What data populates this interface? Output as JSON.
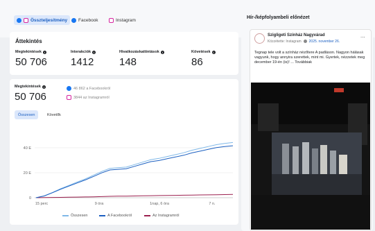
{
  "tabs": [
    {
      "label": "Összteljesítmény",
      "icon": "fb-ig-combined-icon"
    },
    {
      "label": "Facebook",
      "icon": "facebook-icon"
    },
    {
      "label": "Instagram",
      "icon": "instagram-icon"
    }
  ],
  "overview": {
    "title": "Áttekintés",
    "metrics": [
      {
        "label": "Megtekintések",
        "value": "50 706"
      },
      {
        "label": "Interakciók",
        "value": "1412"
      },
      {
        "label": "Hivatkozáskattintások",
        "value": "148"
      },
      {
        "label": "Követések",
        "value": "86"
      }
    ]
  },
  "views": {
    "label": "Megtekintések",
    "value": "50 706",
    "facebook": "46 862 a Facebookról",
    "instagram": "3844 az Instagramról",
    "toggle": [
      "Összesen",
      "Követők"
    ]
  },
  "chart_data": {
    "type": "line",
    "x_ticks": [
      "15 perc",
      "9 óra",
      "1nap, 6 óra",
      "7 n."
    ],
    "y_ticks": [
      "0",
      "20 E",
      "40 E"
    ],
    "ylim": [
      0,
      50000
    ],
    "series": [
      {
        "name": "Összesen",
        "color": "#7fb8e8",
        "values": [
          0,
          1500,
          4200,
          7200,
          9800,
          12500,
          15000,
          18000,
          21000,
          23500,
          24000,
          24500,
          26500,
          28500,
          30500,
          31500,
          33000,
          34500,
          36000,
          38000,
          39500,
          41000,
          42500,
          43500,
          44200
        ]
      },
      {
        "name": "A Facebookról",
        "color": "#1b5fc1",
        "values": [
          0,
          1400,
          4000,
          6800,
          9300,
          11800,
          14200,
          17000,
          19900,
          22200,
          22700,
          23200,
          25100,
          27000,
          28900,
          29800,
          31200,
          32600,
          34000,
          35900,
          37300,
          38700,
          40100,
          41000,
          41600
        ]
      },
      {
        "name": "Az Instagramról",
        "color": "#9b1f4e",
        "values": [
          0,
          100,
          200,
          300,
          400,
          500,
          600,
          700,
          900,
          1100,
          1200,
          1300,
          1400,
          1500,
          1600,
          1700,
          1800,
          1900,
          2000,
          2100,
          2200,
          2300,
          2400,
          2500,
          2600
        ]
      }
    ]
  },
  "preview": {
    "title": "Hír-/képfolyambeli előnézet",
    "page_name": "Szigligeti Színház Nagyvárad",
    "meta": "Közzétette: Instagram",
    "date": "2025. november 26.",
    "text": "Tegnap tele volt a színház nézőtere A padláson. Nagyon hálásak vagyunk, hogy annyira szerettek, mint mi. Gyertek, nézzetek meg december 19-én (is)! ... Továbbiak",
    "more": "..."
  }
}
